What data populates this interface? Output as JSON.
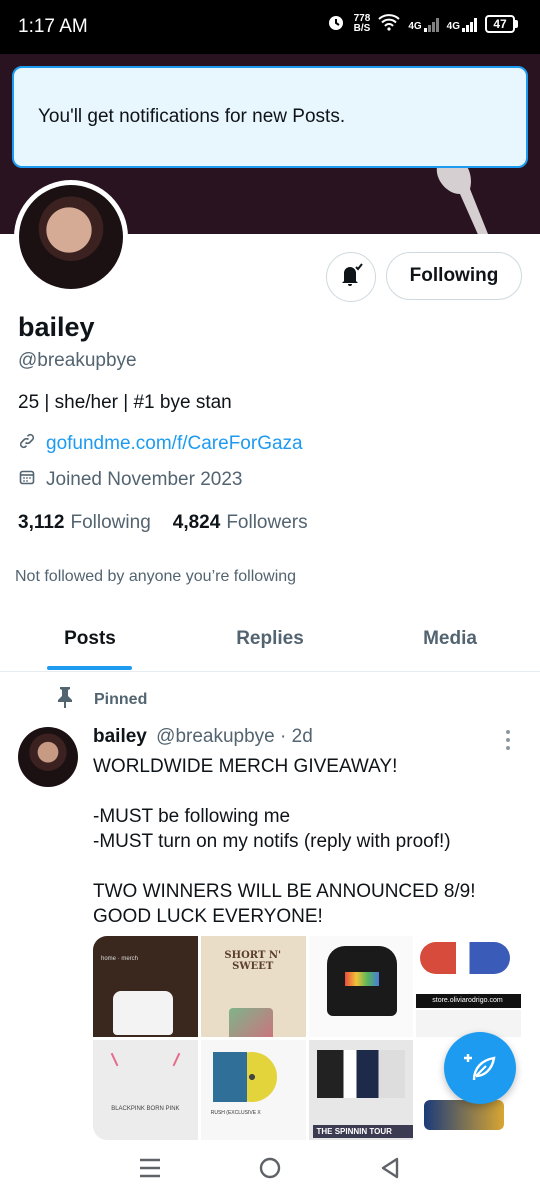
{
  "status_bar": {
    "time": "1:17 AM",
    "net_speed_value": "778",
    "net_speed_unit": "B/S",
    "network1": "4G",
    "network2": "4G",
    "battery": "47"
  },
  "toast": {
    "text": "You'll get notifications for new Posts."
  },
  "profile": {
    "follow_button_label": "Following",
    "name": "bailey",
    "handle": "@breakupbye",
    "bio": "25 | she/her | #1 bye stan",
    "link": "gofundme.com/f/CareForGaza",
    "joined": "Joined November 2023",
    "following_count": "3,112",
    "following_label": "Following",
    "followers_count": "4,824",
    "followers_label": "Followers",
    "not_followed_note": "Not followed by anyone you’re following"
  },
  "tabs": [
    {
      "label": "Posts",
      "active": true
    },
    {
      "label": "Replies",
      "active": false
    },
    {
      "label": "Media",
      "active": false
    }
  ],
  "post": {
    "pinned_label": "Pinned",
    "author_name": "bailey",
    "author_handle": "@breakupbye",
    "time": "· 2d",
    "text": "WORLDWIDE MERCH GIVEAWAY!\n\n-MUST be following me\n-MUST turn on my notifs (reply with proof!)\n\nTWO WINNERS WILL BE ANNOUNCED 8/9!\nGOOD LUCK EVERYONE!",
    "media": {
      "tile1_label": "home · merch",
      "tile2_label": "SHORT N' SWEET",
      "tile4_label": "store.oliviarodrigo.com",
      "tile5_label": "BLACKPINK  BORN PINK",
      "tile6_label": "RUSH (EXCLUSIVE X",
      "tile7_label": "THE SPINNIN TOUR"
    }
  },
  "colors": {
    "accent": "#1d9bf0",
    "text": "#0f1419",
    "secondary": "#536471"
  }
}
